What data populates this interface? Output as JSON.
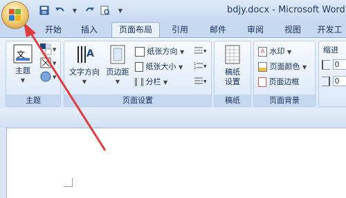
{
  "title": "bdjy.docx - Microsoft Word",
  "tabs": [
    {
      "label": "开始"
    },
    {
      "label": "插入"
    },
    {
      "label": "页面布局"
    },
    {
      "label": "引用"
    },
    {
      "label": "邮件"
    },
    {
      "label": "审阅"
    },
    {
      "label": "视图"
    },
    {
      "label": "开发工"
    }
  ],
  "groups": {
    "theme": {
      "label": "主题",
      "theme_button": "主题",
      "theme_icon_text": "文"
    },
    "page_setup": {
      "label": "页面设置",
      "text_direction": "文字方向",
      "margins": "页边距",
      "orientation": "纸张方向",
      "size": "纸张大小",
      "columns": "分栏"
    },
    "manuscript": {
      "label": "稿纸",
      "button": "稿纸\n设置"
    },
    "background": {
      "label": "页面背景",
      "watermark": "水印",
      "page_color": "页面颜色",
      "page_border": "页面边框"
    },
    "paragraph": {
      "indent_label": "缩进",
      "indent_left": "0",
      "indent_right": "0"
    }
  }
}
